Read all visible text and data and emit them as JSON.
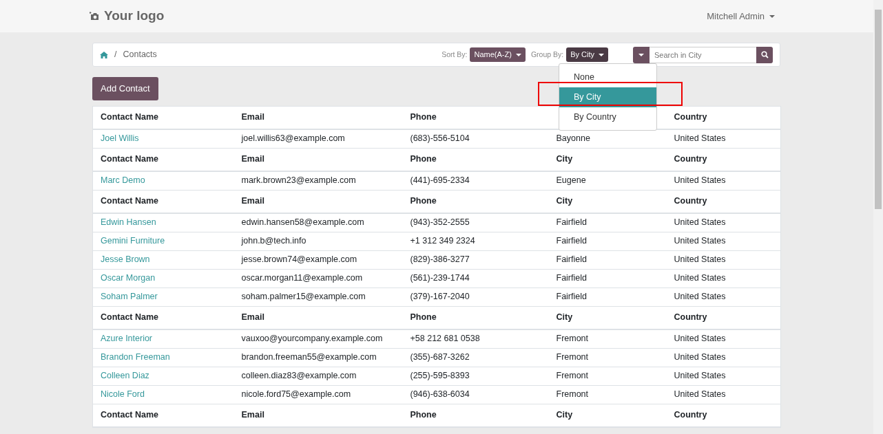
{
  "navbar": {
    "logo": "Your logo",
    "user": "Mitchell Admin"
  },
  "breadcrumb": {
    "separator": "/",
    "current": "Contacts"
  },
  "sort": {
    "label": "Sort By:",
    "value": "Name(A-Z)"
  },
  "group": {
    "label": "Group By:",
    "value": "By City",
    "options": [
      {
        "label": "None",
        "selected": false
      },
      {
        "label": "By City",
        "selected": true
      },
      {
        "label": "By Country",
        "selected": false
      }
    ]
  },
  "search": {
    "placeholder": "Search in City"
  },
  "add_button": "Add Contact",
  "table": {
    "groups": [
      {
        "columns": [
          "Contact Name",
          "Email",
          "Phone",
          null,
          "Country"
        ],
        "rows": [
          [
            "Joel Willis",
            "joel.willis63@example.com",
            "(683)-556-5104",
            "Bayonne",
            "United States"
          ]
        ]
      },
      {
        "columns": [
          "Contact Name",
          "Email",
          "Phone",
          "City",
          "Country"
        ],
        "rows": [
          [
            "Marc Demo",
            "mark.brown23@example.com",
            "(441)-695-2334",
            "Eugene",
            "United States"
          ]
        ]
      },
      {
        "columns": [
          "Contact Name",
          "Email",
          "Phone",
          "City",
          "Country"
        ],
        "rows": [
          [
            "Edwin Hansen",
            "edwin.hansen58@example.com",
            "(943)-352-2555",
            "Fairfield",
            "United States"
          ],
          [
            "Gemini Furniture",
            "john.b@tech.info",
            "+1 312 349 2324",
            "Fairfield",
            "United States"
          ],
          [
            "Jesse Brown",
            "jesse.brown74@example.com",
            "(829)-386-3277",
            "Fairfield",
            "United States"
          ],
          [
            "Oscar Morgan",
            "oscar.morgan11@example.com",
            "(561)-239-1744",
            "Fairfield",
            "United States"
          ],
          [
            "Soham Palmer",
            "soham.palmer15@example.com",
            "(379)-167-2040",
            "Fairfield",
            "United States"
          ]
        ]
      },
      {
        "columns": [
          "Contact Name",
          "Email",
          "Phone",
          "City",
          "Country"
        ],
        "rows": [
          [
            "Azure Interior",
            "vauxoo@yourcompany.example.com",
            "+58 212 681 0538",
            "Fremont",
            "United States"
          ],
          [
            "Brandon Freeman",
            "brandon.freeman55@example.com",
            "(355)-687-3262",
            "Fremont",
            "United States"
          ],
          [
            "Colleen Diaz",
            "colleen.diaz83@example.com",
            "(255)-595-8393",
            "Fremont",
            "United States"
          ],
          [
            "Nicole Ford",
            "nicole.ford75@example.com",
            "(946)-638-6034",
            "Fremont",
            "United States"
          ]
        ]
      },
      {
        "columns": [
          "Contact Name",
          "Email",
          "Phone",
          "City",
          "Country"
        ]
      }
    ]
  }
}
